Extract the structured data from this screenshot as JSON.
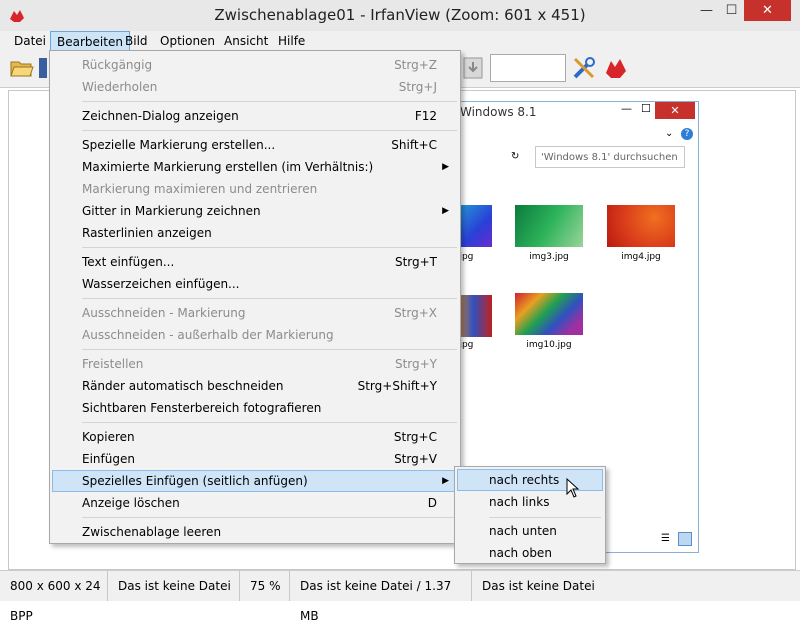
{
  "window": {
    "title": "Zwischenablage01 - IrfanView (Zoom: 601 x 451)",
    "min": "—",
    "max": "☐",
    "close": "✕"
  },
  "menubar": [
    "Datei",
    "Bearbeiten",
    "Bild",
    "Optionen",
    "Ansicht",
    "Hilfe"
  ],
  "dropdown": {
    "items": [
      {
        "label": "Rückgängig",
        "shortcut": "Strg+Z",
        "disabled": true
      },
      {
        "label": "Wiederholen",
        "shortcut": "Strg+J",
        "disabled": true
      },
      {
        "label": "Zeichnen-Dialog anzeigen",
        "shortcut": "F12"
      },
      {
        "label": "Spezielle Markierung erstellen...",
        "shortcut": "Shift+C"
      },
      {
        "label": "Maximierte Markierung erstellen (im Verhältnis:)",
        "shortcut": "",
        "submenu": true
      },
      {
        "label": "Markierung maximieren und zentrieren",
        "shortcut": "",
        "disabled": true
      },
      {
        "label": "Gitter in Markierung zeichnen",
        "shortcut": "",
        "submenu": true
      },
      {
        "label": "Rasterlinien anzeigen",
        "shortcut": ""
      },
      {
        "label": "Text einfügen...",
        "shortcut": "Strg+T"
      },
      {
        "label": "Wasserzeichen einfügen...",
        "shortcut": ""
      },
      {
        "label": "Ausschneiden - Markierung",
        "shortcut": "Strg+X",
        "disabled": true
      },
      {
        "label": "Ausschneiden - außerhalb der Markierung",
        "shortcut": "",
        "disabled": true
      },
      {
        "label": "Freistellen",
        "shortcut": "Strg+Y",
        "disabled": true
      },
      {
        "label": "Ränder automatisch beschneiden",
        "shortcut": "Strg+Shift+Y"
      },
      {
        "label": "Sichtbaren Fensterbereich fotografieren",
        "shortcut": ""
      },
      {
        "label": "Kopieren",
        "shortcut": "Strg+C"
      },
      {
        "label": "Einfügen",
        "shortcut": "Strg+V"
      },
      {
        "label": "Spezielles Einfügen (seitlich anfügen)",
        "shortcut": "",
        "submenu": true,
        "highlighted": true
      },
      {
        "label": "Anzeige löschen",
        "shortcut": "D"
      },
      {
        "label": "Zwischenablage leeren",
        "shortcut": ""
      }
    ]
  },
  "submenu": {
    "items": [
      "nach rechts",
      "nach links",
      "nach unten",
      "nach oben"
    ],
    "highlighted_index": 0
  },
  "explorer": {
    "title": "Windows 8.1",
    "search_placeholder": "'Windows 8.1' durchsuchen",
    "thumbs": [
      "img3.jpg",
      "img4.jpg",
      "img10.jpg"
    ],
    "partial_labels": [
      ".jpg",
      ".jpg"
    ]
  },
  "statusbar": [
    "800 x 600 x 24 BPP",
    "Das ist keine Datei",
    "75 %",
    "Das ist keine Datei / 1.37 MB",
    "Das ist keine Datei"
  ],
  "icons": {
    "app": "irfanview-cat-icon",
    "tools": "tools-icon",
    "irfan": "irfanview-icon"
  }
}
